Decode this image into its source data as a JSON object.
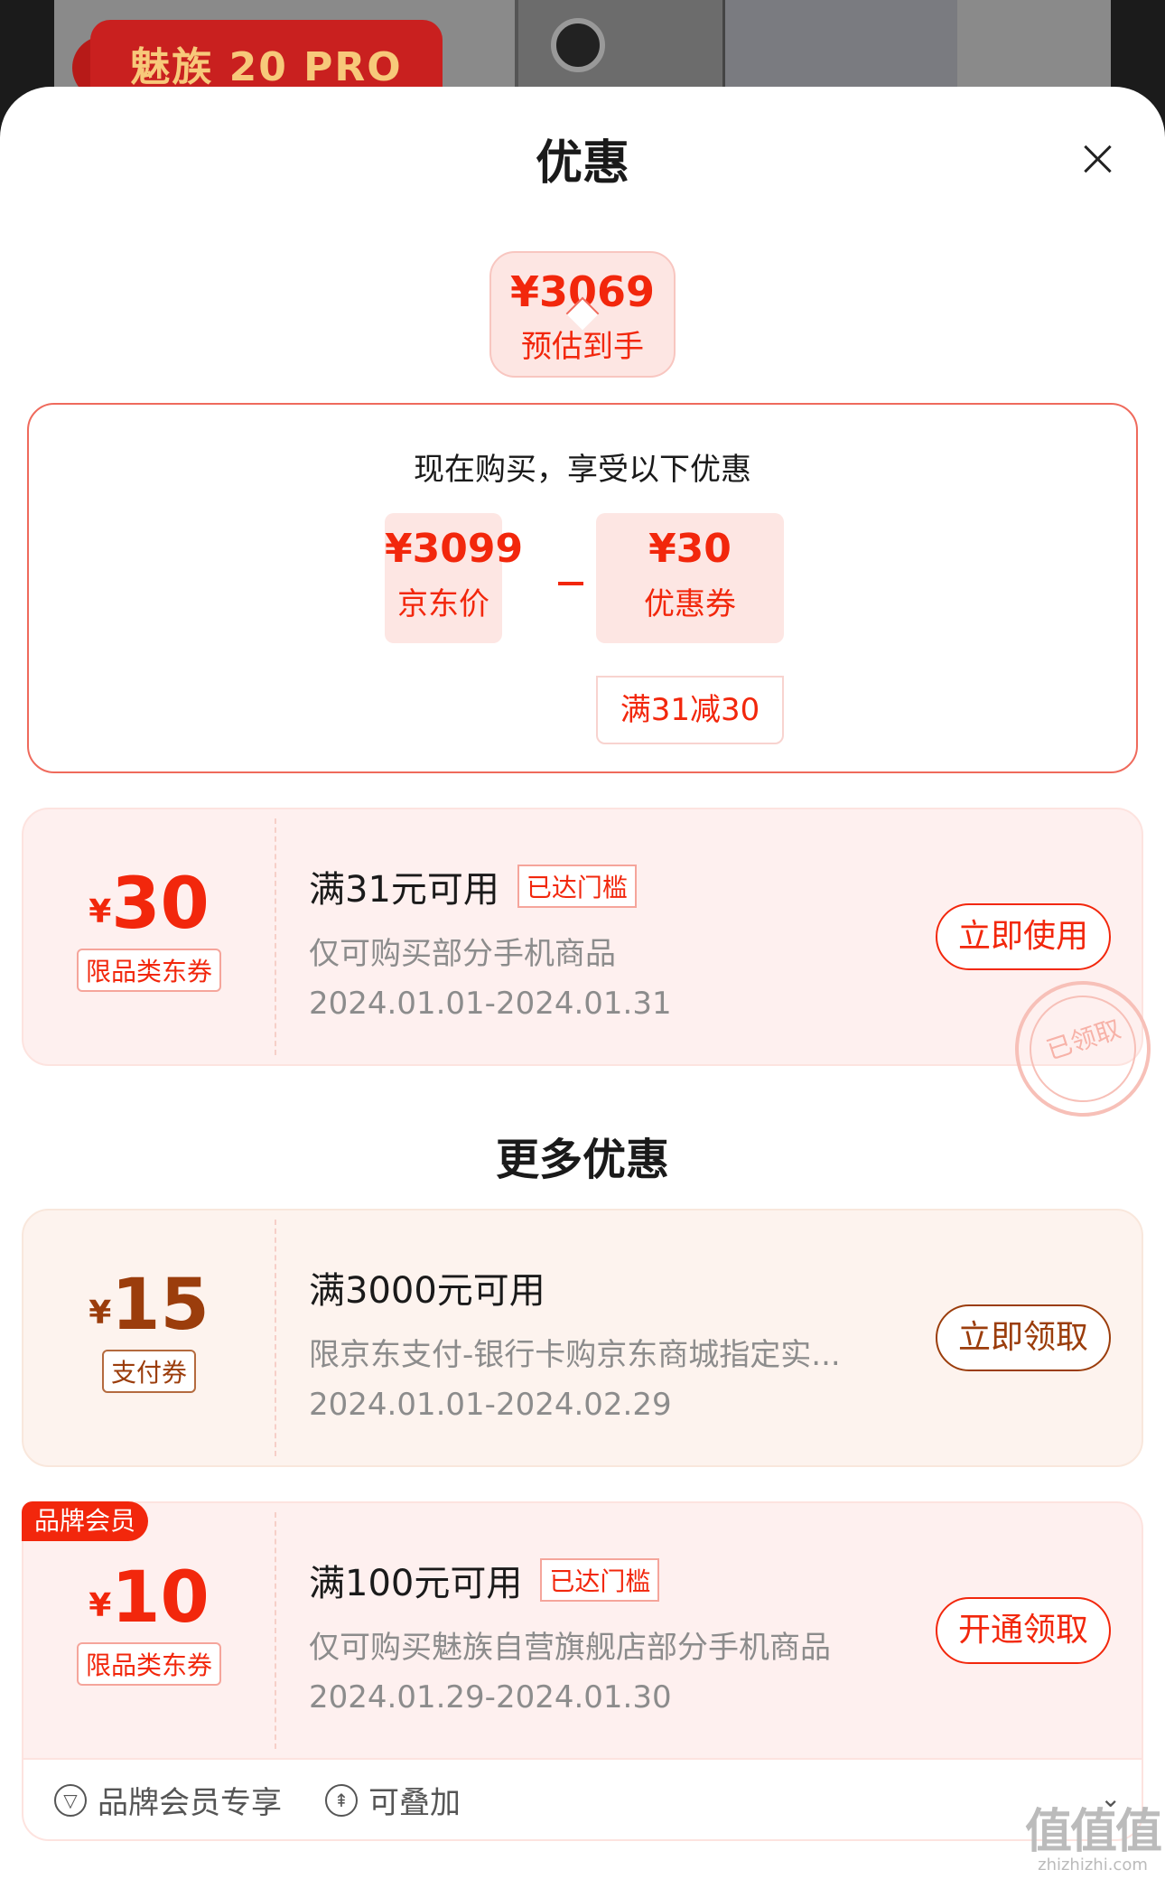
{
  "background": {
    "banner_text": "魅族 20 PRO"
  },
  "sheet": {
    "title": "优惠",
    "close_label": "×"
  },
  "estimate": {
    "price": "¥3069",
    "label": "预估到手"
  },
  "breakdown": {
    "title": "现在购买，享受以下优惠",
    "jd_price": {
      "price": "¥3099",
      "label": "京东价"
    },
    "operator": "−",
    "coupon": {
      "price": "¥30",
      "label": "优惠券",
      "condition": "满31减30"
    }
  },
  "coupon_main": {
    "currency": "¥",
    "amount": "30",
    "type": "限品类东券",
    "headline": "满31元可用",
    "badge": "已达门槛",
    "desc": "仅可购买部分手机商品",
    "date": "2024.01.01-2024.01.31",
    "button": "立即使用",
    "stamp": "已领取"
  },
  "more_title": "更多优惠",
  "coupon_pay": {
    "currency": "¥",
    "amount": "15",
    "type": "支付券",
    "headline": "满3000元可用",
    "desc": "限京东支付-银行卡购京东商城指定实...",
    "date": "2024.01.01-2024.02.29",
    "button": "立即领取"
  },
  "coupon_member": {
    "ribbon": "品牌会员",
    "currency": "¥",
    "amount": "10",
    "type": "限品类东券",
    "headline": "满100元可用",
    "badge": "已达门槛",
    "desc": "仅可购买魅族自营旗舰店部分手机商品",
    "date": "2024.01.29-2024.01.30",
    "button": "开通领取",
    "footer": {
      "member_only": "品牌会员专享",
      "stackable": "可叠加"
    }
  },
  "watermark": {
    "big": "值值值",
    "small": "zhizhizhi.com"
  },
  "colors": {
    "accent": "#f2270c",
    "brown": "#9b3d0c"
  }
}
